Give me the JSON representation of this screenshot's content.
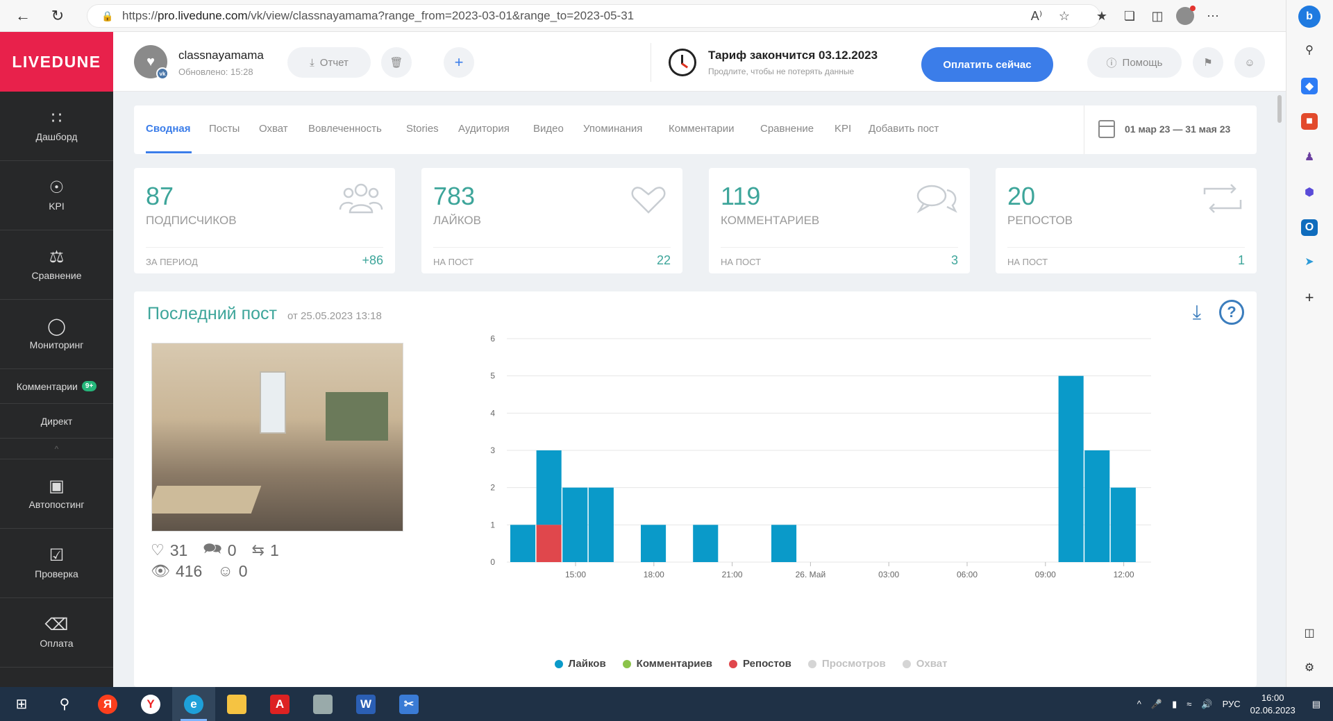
{
  "browser": {
    "url_prefix": "https://",
    "url_host": "pro.livedune.com",
    "url_rest": "/vk/view/classnayamama?range_from=2023-03-01&range_to=2023-05-31"
  },
  "sidebar": {
    "logo": "LIVEDUNE",
    "items": [
      {
        "label": "Дашборд",
        "icon": "grid-icon"
      },
      {
        "label": "KPI",
        "icon": "target-icon"
      },
      {
        "label": "Сравнение",
        "icon": "scales-icon"
      },
      {
        "label": "Мониторинг",
        "icon": "chat-bubble-icon"
      }
    ],
    "comments_label": "Комментарии",
    "comments_badge": "9+",
    "direct_label": "Директ",
    "bottom_items": [
      {
        "label": "Автопостинг",
        "icon": "calendar-plus-icon"
      },
      {
        "label": "Проверка",
        "icon": "check-box-icon"
      },
      {
        "label": "Оплата",
        "icon": "basket-icon"
      }
    ]
  },
  "header": {
    "account_name": "classnayamama",
    "updated": "Обновлено: 15:28",
    "report_label": "Отчет",
    "tariff_title": "Тариф закончится 03.12.2023",
    "tariff_sub": "Продлите, чтобы не потерять данные",
    "pay_label": "Оплатить сейчас",
    "help_label": "Помощь"
  },
  "tabs": [
    "Сводная",
    "Посты",
    "Охват",
    "Вовлеченность",
    "Stories",
    "Аудитория",
    "Видео",
    "Упоминания",
    "Комментарии",
    "Сравнение",
    "KPI",
    "Добавить пост"
  ],
  "date_range": "01 мар 23 — 31 мая 23",
  "stats": [
    {
      "value": "87",
      "label": "Подписчиков",
      "foot": "За период",
      "foot_value": "+86",
      "icon": "users-icon"
    },
    {
      "value": "783",
      "label": "Лайков",
      "foot": "На пост",
      "foot_value": "22",
      "icon": "heart-icon"
    },
    {
      "value": "119",
      "label": "Комментариев",
      "foot": "На пост",
      "foot_value": "3",
      "icon": "comments-icon"
    },
    {
      "value": "20",
      "label": "Репостов",
      "foot": "На пост",
      "foot_value": "1",
      "icon": "repost-icon"
    }
  ],
  "last_post": {
    "title": "Последний пост",
    "date": "от 25.05.2023 13:18",
    "likes": "31",
    "comments": "0",
    "reposts": "1",
    "views": "416",
    "reach": "0"
  },
  "chart_data": {
    "type": "bar",
    "x_ticks": [
      "15:00",
      "18:00",
      "21:00",
      "26. Май",
      "03:00",
      "06:00",
      "09:00",
      "12:00"
    ],
    "ylim": [
      0,
      6
    ],
    "y_ticks": [
      0,
      1,
      2,
      3,
      4,
      5,
      6
    ],
    "bars": [
      {
        "slot": 0,
        "series": "Лайков",
        "value": 1
      },
      {
        "slot": 1,
        "series": "Лайков",
        "value": 2,
        "base": 1
      },
      {
        "slot": 1,
        "series": "Репостов",
        "value": 1
      },
      {
        "slot": 2,
        "series": "Лайков",
        "value": 2
      },
      {
        "slot": 3,
        "series": "Лайков",
        "value": 2
      },
      {
        "slot": 5,
        "series": "Лайков",
        "value": 1
      },
      {
        "slot": 7,
        "series": "Лайков",
        "value": 1
      },
      {
        "slot": 10,
        "series": "Лайков",
        "value": 1
      },
      {
        "slot": 21,
        "series": "Лайков",
        "value": 5
      },
      {
        "slot": 22,
        "series": "Лайков",
        "value": 3
      },
      {
        "slot": 23,
        "series": "Лайков",
        "value": 2
      }
    ],
    "series": [
      {
        "name": "Лайков",
        "color": "#0a9ac9",
        "enabled": true
      },
      {
        "name": "Комментариев",
        "color": "#8bc34a",
        "enabled": true
      },
      {
        "name": "Репостов",
        "color": "#e0474c",
        "enabled": true
      },
      {
        "name": "Просмотров",
        "color": "#cfcfcf",
        "enabled": false
      },
      {
        "name": "Охват",
        "color": "#cfcfcf",
        "enabled": false
      }
    ],
    "legend_position": "bottom",
    "grid": true
  },
  "taskbar": {
    "lang": "РУС",
    "time": "16:00",
    "date": "02.06.2023"
  }
}
